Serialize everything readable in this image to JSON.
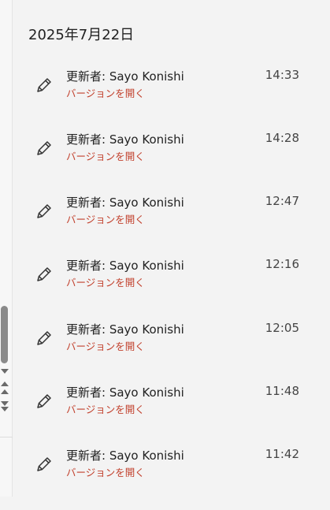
{
  "date_header": "2025年7月22日",
  "versions": [
    {
      "author": "更新者: Sayo Konishi",
      "link": "バージョンを開く",
      "time": "14:33"
    },
    {
      "author": "更新者: Sayo Konishi",
      "link": "バージョンを開く",
      "time": "14:28"
    },
    {
      "author": "更新者: Sayo Konishi",
      "link": "バージョンを開く",
      "time": "12:47"
    },
    {
      "author": "更新者: Sayo Konishi",
      "link": "バージョンを開く",
      "time": "12:16"
    },
    {
      "author": "更新者: Sayo Konishi",
      "link": "バージョンを開く",
      "time": "12:05"
    },
    {
      "author": "更新者: Sayo Konishi",
      "link": "バージョンを開く",
      "time": "11:48"
    },
    {
      "author": "更新者: Sayo Konishi",
      "link": "バージョンを開く",
      "time": "11:42"
    }
  ],
  "icons": {
    "edit": "pencil-icon"
  },
  "colors": {
    "link": "#c2412d",
    "background": "#f3f3f3"
  }
}
